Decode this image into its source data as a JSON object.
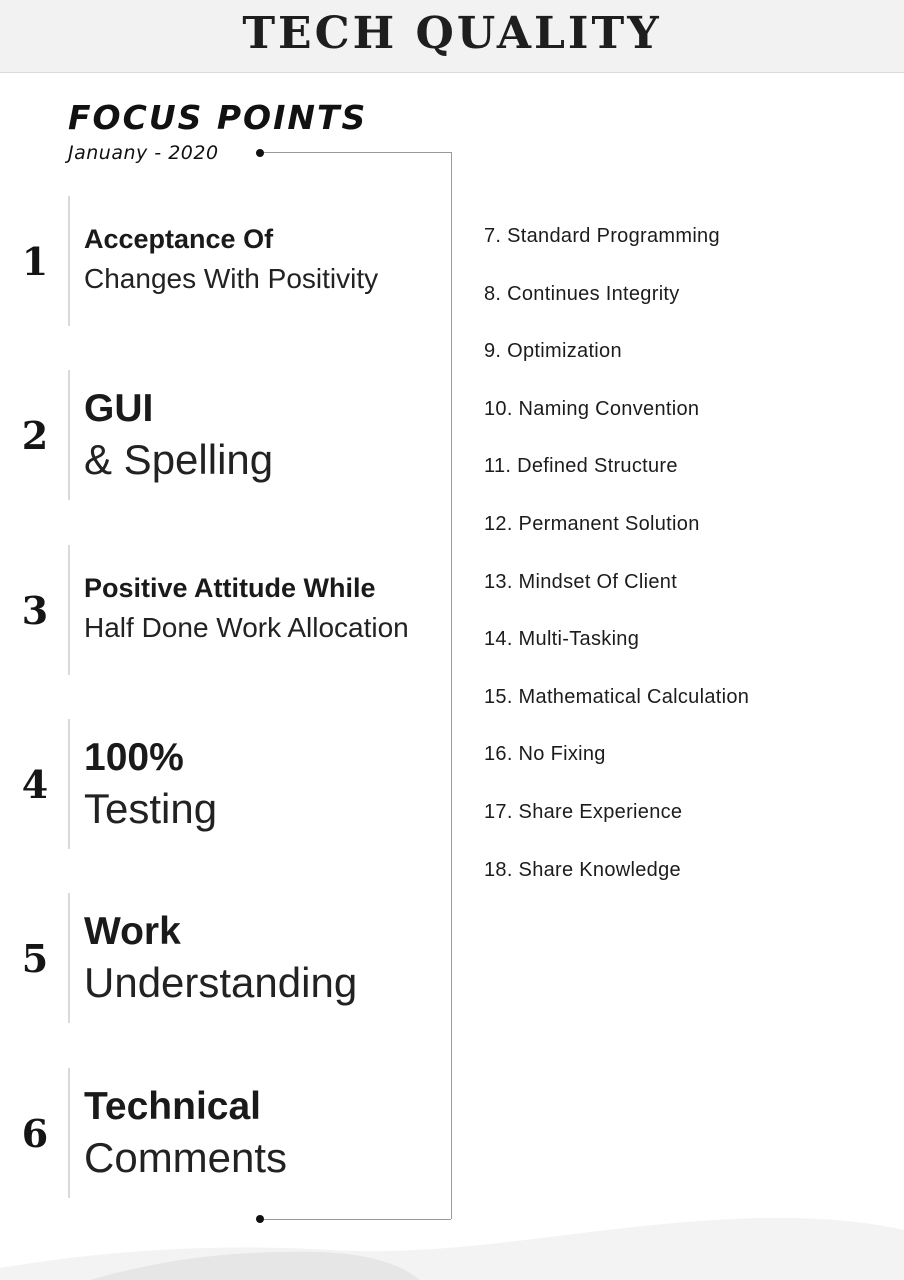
{
  "header": {
    "title": "TECH QUALITY"
  },
  "section": {
    "title": "FOCUS POINTS",
    "date": "Januany - 2020"
  },
  "points": [
    {
      "number": "1",
      "line1": "Acceptance Of",
      "line2": "Changes With Positivity"
    },
    {
      "number": "2",
      "line1": "GUI",
      "line2": "& Spelling"
    },
    {
      "number": "3",
      "line1": "Positive Attitude While",
      "line2": "Half Done Work Allocation"
    },
    {
      "number": "4",
      "line1": "100%",
      "line2": "Testing"
    },
    {
      "number": "5",
      "line1": "Work",
      "line2": "Understanding"
    },
    {
      "number": "6",
      "line1": "Technical",
      "line2": "Comments"
    }
  ],
  "extra_points": [
    "7. Standard Programming",
    "8. Continues Integrity",
    "9. Optimization",
    "10. Naming Convention",
    "11. Defined Structure",
    "12. Permanent Solution",
    "13. Mindset Of Client",
    "14. Multi-Tasking",
    "15. Mathematical Calculation",
    "16. No Fixing",
    "17. Share Experience",
    "18. Share Knowledge"
  ],
  "colors": {
    "header_band": "#f2f2f2",
    "text": "#1a1a1a",
    "rule": "#9a9a9a",
    "divider": "#d9d9d9"
  }
}
